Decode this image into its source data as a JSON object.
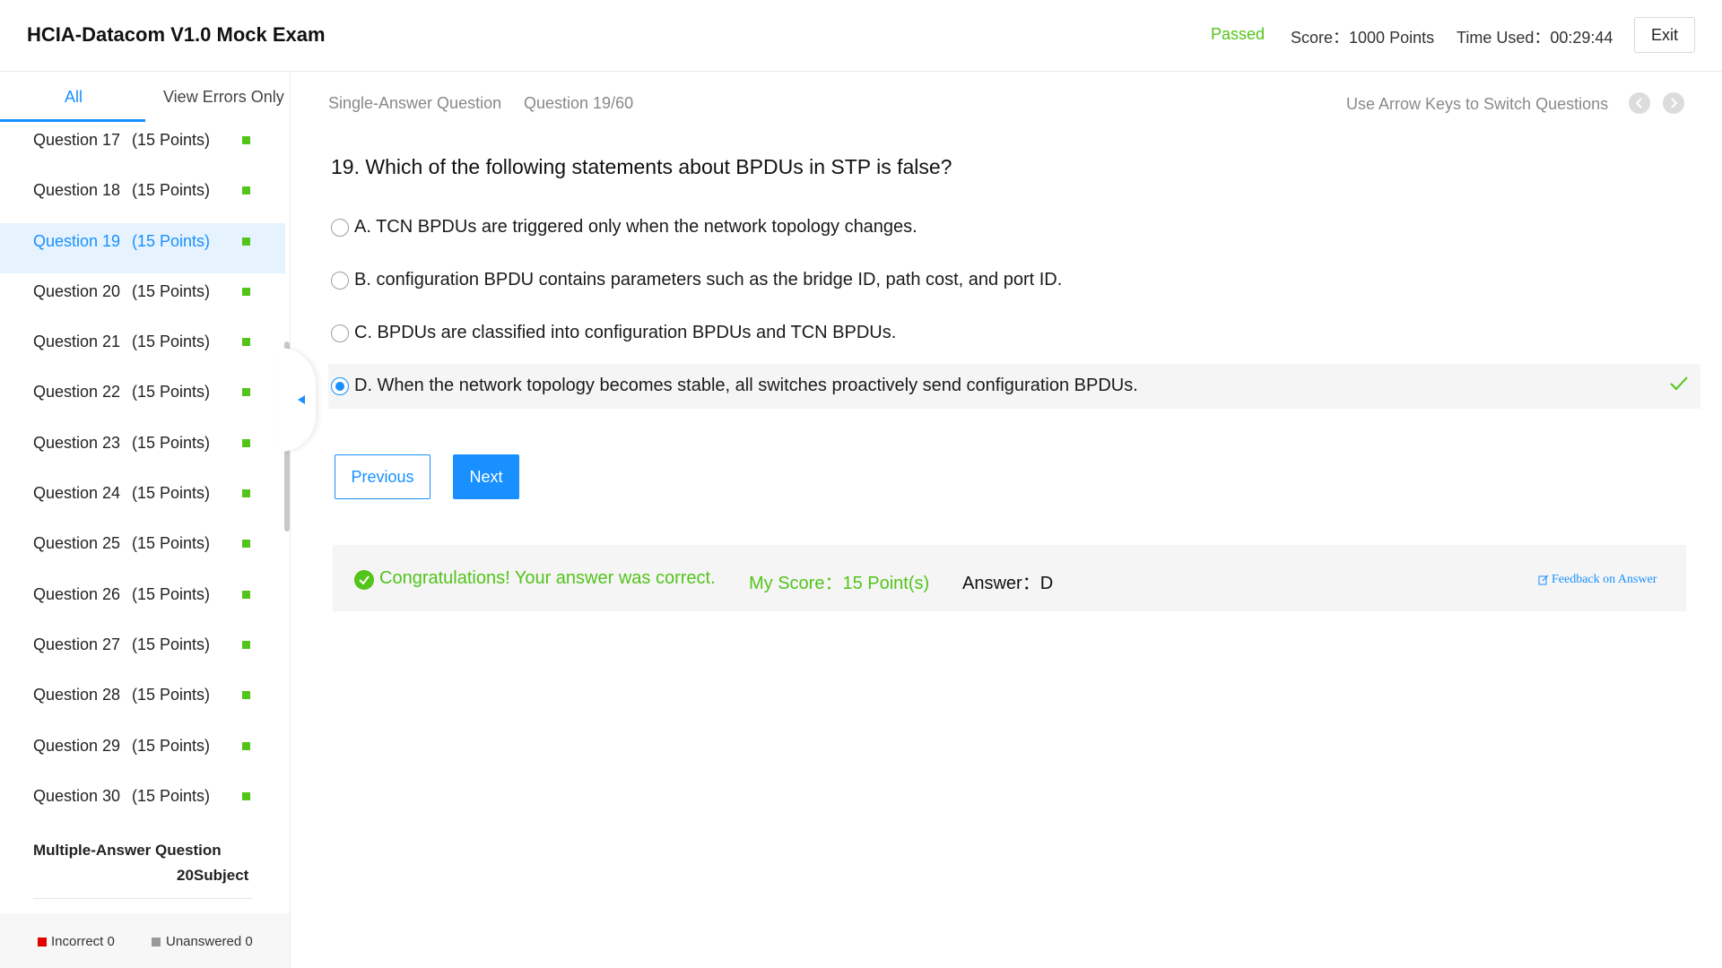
{
  "header": {
    "title": "HCIA-Datacom V1.0 Mock Exam",
    "status": "Passed",
    "score": "Score：1000 Points",
    "time_used": "Time Used：00:29:44",
    "exit_label": "Exit"
  },
  "colors": {
    "accent": "#1890ff",
    "success": "#52c41a",
    "incorrect": "#e00000",
    "unanswered": "#9a9a9a"
  },
  "sidebar": {
    "tabs": [
      {
        "label": "All",
        "active": true
      },
      {
        "label": "View Errors Only",
        "active": false
      }
    ],
    "questions": [
      {
        "label": "Question 17",
        "points": "(15 Points)",
        "active": false
      },
      {
        "label": "Question 18",
        "points": "(15 Points)",
        "active": false
      },
      {
        "label": "Question 19",
        "points": "(15 Points)",
        "active": true
      },
      {
        "label": "Question 20",
        "points": "(15 Points)",
        "active": false
      },
      {
        "label": "Question 21",
        "points": "(15 Points)",
        "active": false
      },
      {
        "label": "Question 22",
        "points": "(15 Points)",
        "active": false
      },
      {
        "label": "Question 23",
        "points": "(15 Points)",
        "active": false
      },
      {
        "label": "Question 24",
        "points": "(15 Points)",
        "active": false
      },
      {
        "label": "Question 25",
        "points": "(15 Points)",
        "active": false
      },
      {
        "label": "Question 26",
        "points": "(15 Points)",
        "active": false
      },
      {
        "label": "Question 27",
        "points": "(15 Points)",
        "active": false
      },
      {
        "label": "Question 28",
        "points": "(15 Points)",
        "active": false
      },
      {
        "label": "Question 29",
        "points": "(15 Points)",
        "active": false
      },
      {
        "label": "Question 30",
        "points": "(15 Points)",
        "active": false
      }
    ],
    "section_heading": "Multiple-Answer Question",
    "section_subject": "20Subject",
    "legend": {
      "incorrect": "Incorrect 0",
      "unanswered": "Unanswered 0"
    }
  },
  "main": {
    "question_type": "Single-Answer Question",
    "question_counter": "Question 19/60",
    "arrow_hint": "Use Arrow Keys to Switch Questions",
    "question_text": "19. Which of the following statements about BPDUs in STP is false?",
    "options": [
      {
        "text": "A. TCN BPDUs are triggered only when the network topology changes.",
        "selected": false
      },
      {
        "text": "B. configuration BPDU contains parameters such as the bridge ID, path cost, and port ID.",
        "selected": false
      },
      {
        "text": "C. BPDUs are classified into configuration BPDUs and TCN BPDUs.",
        "selected": false
      },
      {
        "text": "D. When the network topology becomes stable, all switches proactively send configuration BPDUs.",
        "selected": true
      }
    ],
    "previous_label": "Previous",
    "next_label": "Next",
    "result": {
      "message": "Congratulations! Your answer was correct.",
      "my_score": "My Score：15 Point(s)",
      "answer": "Answer：D",
      "feedback": "Feedback on Answer"
    }
  }
}
